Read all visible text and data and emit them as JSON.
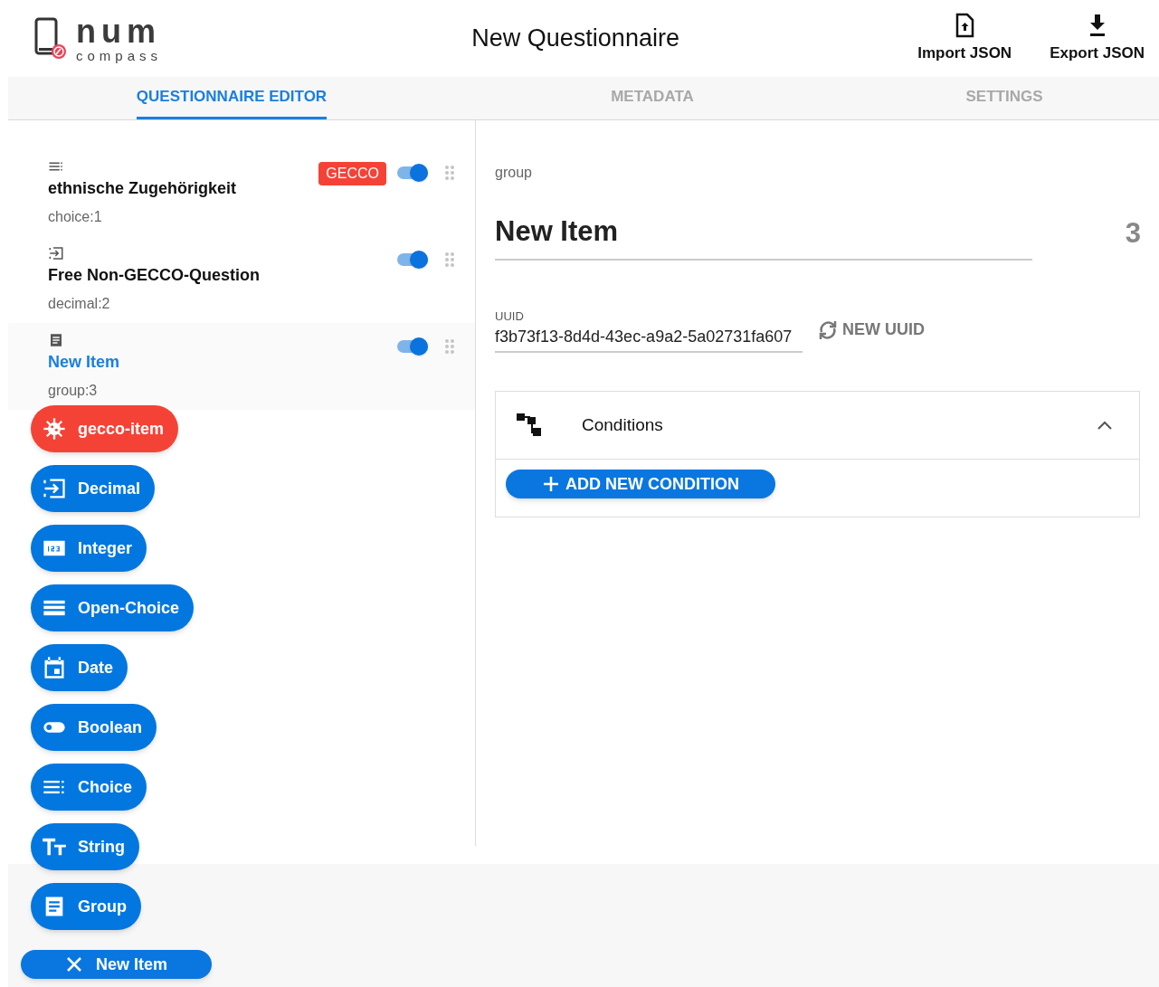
{
  "logo": {
    "word": "num",
    "subword": "compass"
  },
  "title": "New Questionnaire",
  "header_actions": [
    {
      "kind": "import",
      "label": "Import JSON"
    },
    {
      "kind": "export",
      "label": "Export JSON"
    }
  ],
  "tabs": [
    {
      "label": "QUESTIONNAIRE EDITOR",
      "selected": true
    },
    {
      "label": "METADATA",
      "selected": false
    },
    {
      "label": "SETTINGS",
      "selected": false
    }
  ],
  "items": [
    {
      "kind": "choice",
      "title": "ethnische Zugehörigkeit",
      "subtitle": "choice:1",
      "badge": "GECCO",
      "on": true,
      "selected": false
    },
    {
      "kind": "decimal",
      "title": "Free Non-GECCO-Question",
      "subtitle": "decimal:2",
      "on": true,
      "selected": false
    },
    {
      "kind": "group",
      "title": "New Item",
      "subtitle": "group:3",
      "on": true,
      "selected": true
    }
  ],
  "speed_dial": [
    {
      "kind": "gecco",
      "label": "gecco-item",
      "color": "#f44336"
    },
    {
      "kind": "decimal",
      "label": "Decimal",
      "color": "#0277e0"
    },
    {
      "kind": "integer",
      "label": "Integer",
      "color": "#0277e0"
    },
    {
      "kind": "open-choice",
      "label": "Open-Choice",
      "color": "#0277e0"
    },
    {
      "kind": "date",
      "label": "Date",
      "color": "#0277e0"
    },
    {
      "kind": "boolean",
      "label": "Boolean",
      "color": "#0277e0"
    },
    {
      "kind": "choice",
      "label": "Choice",
      "color": "#0277e0"
    },
    {
      "kind": "string",
      "label": "String",
      "color": "#0277e0"
    },
    {
      "kind": "group",
      "label": "Group",
      "color": "#0277e0"
    }
  ],
  "fab": {
    "label": "New Item"
  },
  "detail": {
    "type": "group",
    "title": "New Item",
    "number": "3",
    "uuid_label": "UUID",
    "uuid": "f3b73f13-8d4d-43ec-a9a2-5a02731fa607",
    "new_uuid": "NEW UUID",
    "conditions": {
      "title": "Conditions",
      "expanded": true,
      "add": "ADD NEW CONDITION"
    }
  }
}
